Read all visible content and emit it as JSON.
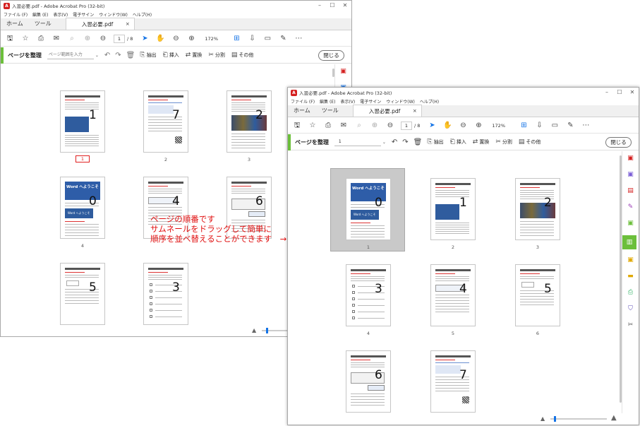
{
  "window_back": {
    "title": "入習必要.pdf - Adobe Acrobat Pro (32-bit)",
    "menu": [
      "ファイル (F)",
      "編集 (E)",
      "表示(V)",
      "電子サイン",
      "ウィンドウ(W)",
      "ヘルプ(H)"
    ],
    "tabs": {
      "home": "ホーム",
      "tools": "ツール",
      "document": "入習必要.pdf",
      "close": "×"
    },
    "toolbar": {
      "page_current": "1",
      "page_total": "/ 8",
      "zoom": "172%"
    },
    "organize": {
      "title": "ページを整理",
      "range_placeholder": "ページ範囲を入力",
      "extract": "抽出",
      "insert": "挿入",
      "replace": "置換",
      "split": "分割",
      "more": "その他",
      "close_label": "閉じる"
    },
    "thumbnails": [
      {
        "order": "1",
        "page": "1",
        "current": true,
        "style": "text"
      },
      {
        "order": "7",
        "page": "2",
        "current": false,
        "style": "qr"
      },
      {
        "order": "2",
        "page": "3",
        "current": false,
        "style": "image"
      },
      {
        "order": "0",
        "page": "4",
        "current": false,
        "style": "cover"
      },
      {
        "order": "4",
        "page": "",
        "current": false,
        "style": "form"
      },
      {
        "order": "6",
        "page": "",
        "current": false,
        "style": "table"
      },
      {
        "order": "5",
        "page": "",
        "current": false,
        "style": "check"
      },
      {
        "order": "3",
        "page": "",
        "current": false,
        "style": "list"
      }
    ]
  },
  "window_front": {
    "title": "入習必要.pdf - Adobe Acrobat Pro (32-bit)",
    "menu": [
      "ファイル (F)",
      "編集 (E)",
      "表示(V)",
      "電子サイン",
      "ウィンドウ(W)",
      "ヘルプ(H)"
    ],
    "tabs": {
      "home": "ホーム",
      "tools": "ツール",
      "document": "入習必要.pdf",
      "close": "×"
    },
    "toolbar": {
      "page_current": "1",
      "page_total": "/ 8",
      "zoom": "172%"
    },
    "organize": {
      "title": "ページを整理",
      "range_value": "1",
      "extract": "抽出",
      "insert": "挿入",
      "replace": "置換",
      "split": "分割",
      "more": "その他",
      "close_label": "閉じる"
    },
    "thumbnails": [
      {
        "order": "0",
        "page": "1",
        "selected": true,
        "style": "cover"
      },
      {
        "order": "1",
        "page": "2",
        "selected": false,
        "style": "text"
      },
      {
        "order": "2",
        "page": "3",
        "selected": false,
        "style": "image"
      },
      {
        "order": "3",
        "page": "4",
        "selected": false,
        "style": "list"
      },
      {
        "order": "4",
        "page": "5",
        "selected": false,
        "style": "form"
      },
      {
        "order": "5",
        "page": "6",
        "selected": false,
        "style": "check"
      },
      {
        "order": "6",
        "page": "",
        "selected": false,
        "style": "table"
      },
      {
        "order": "7",
        "page": "",
        "selected": false,
        "style": "qr"
      }
    ]
  },
  "cover_title": "Word へようこそ",
  "cover_badge": "Word へようこそ",
  "callout": {
    "line1": "ページの順番です",
    "line2": "サムネールをドラッグして簡単に",
    "line3": "順序を並べ替えることができます　→"
  },
  "colors": {
    "accent_green": "#6cbf3b",
    "acrobat_red": "#d41f1f",
    "callout_red": "#e01010",
    "selection_blue": "#1473e6"
  }
}
